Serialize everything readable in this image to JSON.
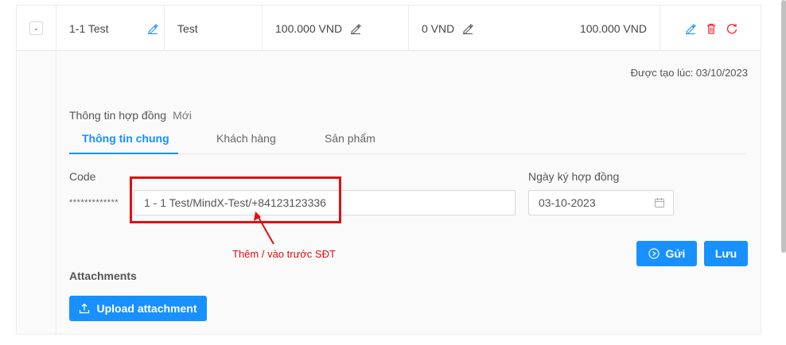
{
  "row": {
    "expander": "-",
    "name": "1-1 Test",
    "type": "Test",
    "price": "100.000 VND",
    "discount": "0 VND",
    "total": "100.000 VND",
    "icons": [
      "edit-icon",
      "delete-icon",
      "reload-icon"
    ]
  },
  "detail": {
    "created_at": "Được tạo lúc: 03/10/2023",
    "contract_label": "Thông tin hợp đồng",
    "contract_status": "Mới",
    "tabs": [
      "Thông tin chung",
      "Khách hàng",
      "Sản phẩm"
    ],
    "code_label": "Code",
    "code_masked": "*************",
    "code_value": "1 - 1 Test/MindX-Test/+84123123336",
    "sign_date_label": "Ngày ký hợp đồng",
    "sign_date_value": "03-10-2023",
    "annotation": "Thêm / vào trước SĐT",
    "send_button": "Gửi",
    "save_button": "Lưu",
    "attachments_label": "Attachments",
    "upload_button": "Upload attachment"
  },
  "colors": {
    "primary": "#1890ff",
    "danger": "#f5222d",
    "annotation": "#e01010"
  }
}
